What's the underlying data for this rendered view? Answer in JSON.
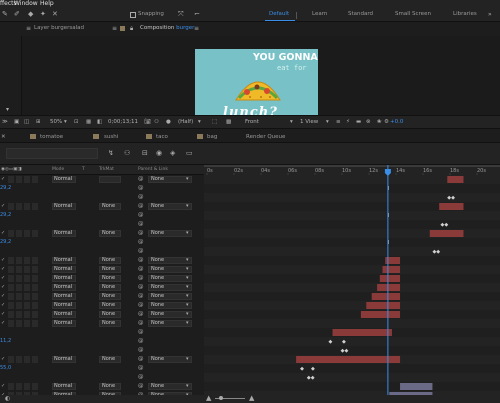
{
  "menu": {
    "items": [
      "ffects",
      "Window",
      "Help"
    ]
  },
  "toolbar": {
    "snapping_label": "Snapping",
    "workspaces": [
      "Default",
      "Learn",
      "Standard",
      "Small Screen",
      "Libraries"
    ],
    "active_workspace": "Default"
  },
  "panels": {
    "layer_tab": "Layer  burgersalad",
    "comp_tab_prefix": "Composition",
    "comp_tab_name": "burger",
    "comp_breadcrumb": "burger"
  },
  "preview": {
    "line1": "YOU GONNA",
    "line2": "eat for",
    "line3": "lunch?"
  },
  "viewer_bar": {
    "zoom": "50%",
    "timecode": "0;00;13;11",
    "resolution": "(Half)",
    "view": "Front",
    "views_count": "1 View",
    "exposure": "+0.0"
  },
  "comp_tabs": [
    "tomatoe",
    "sushi",
    "taco",
    "bag",
    "Render Queue"
  ],
  "timeline": {
    "headers": {
      "mode": "Mode",
      "trkmat": "TrkMat",
      "parent": "Parent & Link",
      "t": "T"
    },
    "ruler": [
      "0s",
      "02s",
      "04s",
      "06s",
      "08s",
      "10s",
      "12s",
      "14s",
      "16s",
      "18s",
      "20s"
    ],
    "rows": [
      {
        "kind": "layer",
        "mode": "Normal",
        "trk": "",
        "parent": "None"
      },
      {
        "kind": "val",
        "value": "29,2"
      },
      {
        "kind": "spiral"
      },
      {
        "kind": "layer",
        "mode": "Normal",
        "trk": "None",
        "parent": "None"
      },
      {
        "kind": "val",
        "value": "29,2"
      },
      {
        "kind": "spiral"
      },
      {
        "kind": "layer",
        "mode": "Normal",
        "trk": "None",
        "parent": "None"
      },
      {
        "kind": "val",
        "value": "29,2"
      },
      {
        "kind": "spiral"
      },
      {
        "kind": "layer",
        "mode": "Normal",
        "trk": "None",
        "parent": "None"
      },
      {
        "kind": "layer",
        "mode": "Normal",
        "trk": "None",
        "parent": "None"
      },
      {
        "kind": "layer",
        "mode": "Normal",
        "trk": "None",
        "parent": "None"
      },
      {
        "kind": "layer",
        "mode": "Normal",
        "trk": "None",
        "parent": "None"
      },
      {
        "kind": "layer",
        "mode": "Normal",
        "trk": "None",
        "parent": "None"
      },
      {
        "kind": "layer",
        "mode": "Normal",
        "trk": "None",
        "parent": "None"
      },
      {
        "kind": "layer",
        "mode": "Normal",
        "trk": "None",
        "parent": "None"
      },
      {
        "kind": "layer",
        "mode": "Normal",
        "trk": "None",
        "parent": "None"
      },
      {
        "kind": "spiral"
      },
      {
        "kind": "val",
        "value": "11,2"
      },
      {
        "kind": "spiral"
      },
      {
        "kind": "layer",
        "mode": "Normal",
        "trk": "None",
        "parent": "None"
      },
      {
        "kind": "val",
        "value": "55,0"
      },
      {
        "kind": "spiral"
      },
      {
        "kind": "layer",
        "mode": "Normal",
        "trk": "None",
        "parent": "None"
      },
      {
        "kind": "layer",
        "mode": "Normal",
        "trk": "None",
        "parent": "None"
      }
    ]
  },
  "colors": {
    "accent": "#3b8ee8",
    "layer_bar": "#8b3a3a",
    "bar_gray": "#6a6a86",
    "panel_bg": "#1d1d1d"
  }
}
